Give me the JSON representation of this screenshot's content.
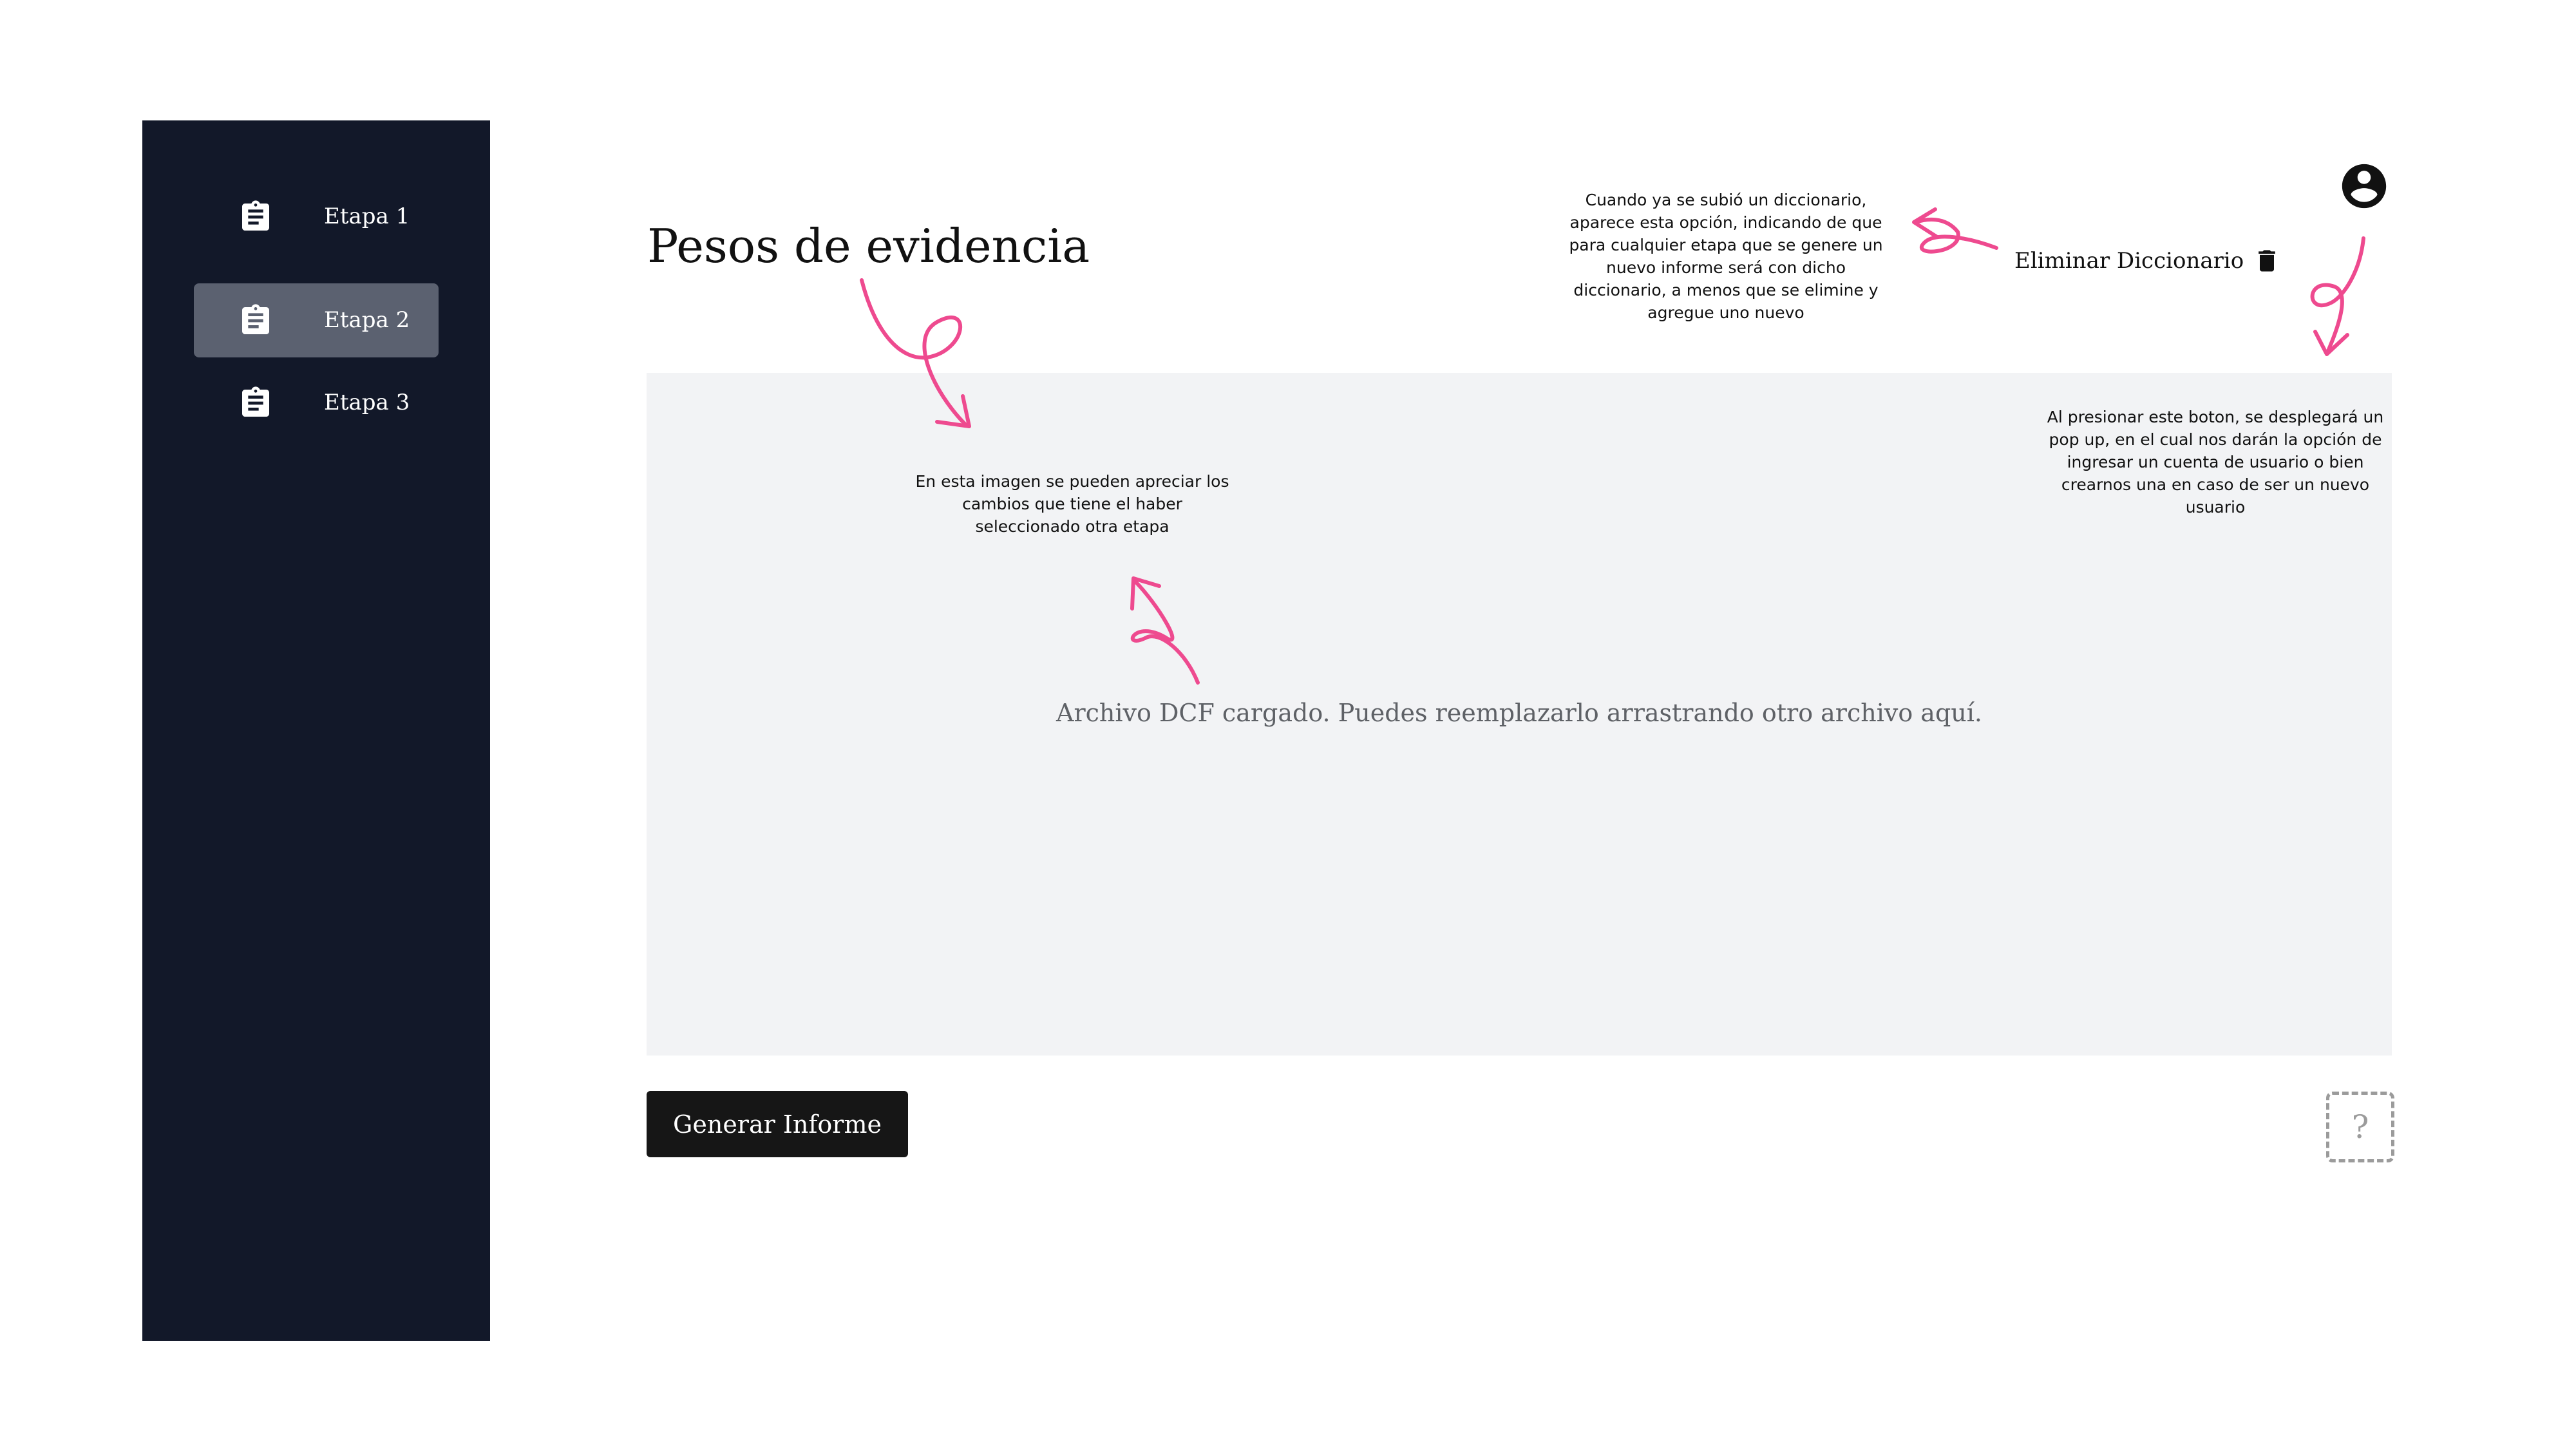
{
  "sidebar": {
    "items": [
      {
        "label": "Etapa 1",
        "icon": "clipboard-icon",
        "active": false
      },
      {
        "label": "Etapa 2",
        "icon": "clipboard-icon",
        "active": true
      },
      {
        "label": "Etapa 3",
        "icon": "clipboard-icon",
        "active": false
      }
    ]
  },
  "header": {
    "title": "Pesos de evidencia",
    "delete_dictionary_label": "Eliminar Diccionario",
    "delete_icon": "trash-icon",
    "user_icon": "user-account-icon"
  },
  "dropzone": {
    "message": "Archivo DCF cargado. Puedes reemplazarlo arrastrando otro archivo aquí."
  },
  "actions": {
    "generate_label": "Generar Informe",
    "help_label": "?"
  },
  "annotations": {
    "dictionary_note": "Cuando ya se subió un diccionario, aparece esta opción, indicando de que para cualquier etapa que se genere un nuevo informe será con dicho diccionario, a menos que se elimine y agregue uno nuevo",
    "stage_note": "En esta imagen se pueden apreciar los cambios que tiene el haber seleccionado otra etapa",
    "user_note": "Al presionar este boton, se desplegará un pop up, en el cual nos darán la opción de ingresar un cuenta de usuario o bien crearnos una en caso de ser un nuevo usuario"
  },
  "colors": {
    "sidebar_bg": "#121829",
    "sidebar_active": "#5b6170",
    "dropzone_bg": "#f2f3f5",
    "button_bg": "#161616",
    "annotation_arrow": "#ee4a8f"
  }
}
